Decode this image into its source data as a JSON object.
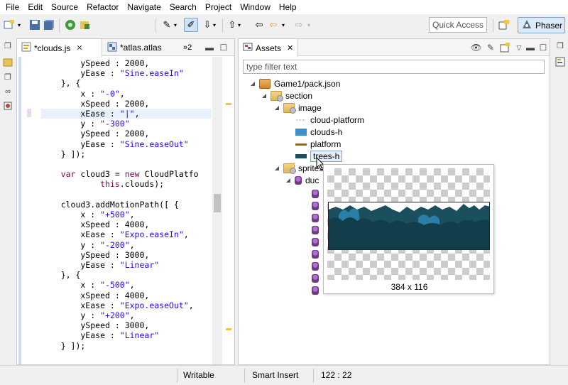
{
  "menu": [
    "File",
    "Edit",
    "Source",
    "Refactor",
    "Navigate",
    "Search",
    "Project",
    "Window",
    "Help"
  ],
  "toolbar": {
    "quick_access_placeholder": "Quick Access",
    "perspective_label": "Phaser"
  },
  "editor": {
    "tabs": [
      {
        "label": "*clouds.js",
        "active": true
      },
      {
        "label": "*atlas.atlas",
        "active": false
      }
    ],
    "overflow_count": "»2",
    "code_lines": [
      [
        {
          "t": "p",
          "v": "        ySpeed : 2000,"
        }
      ],
      [
        {
          "t": "p",
          "v": "        yEase : "
        },
        {
          "t": "s",
          "v": "\"Sine.easeIn\""
        }
      ],
      [
        {
          "t": "p",
          "v": "    }, {"
        }
      ],
      [
        {
          "t": "p",
          "v": "        x : "
        },
        {
          "t": "s",
          "v": "\"-0\""
        },
        {
          "t": "p",
          "v": ","
        }
      ],
      [
        {
          "t": "p",
          "v": "        xSpeed : 2000,"
        }
      ],
      [
        {
          "t": "p",
          "v": "        xEase : "
        },
        {
          "t": "s",
          "v": "\"|\""
        },
        {
          "t": "p",
          "v": ","
        }
      ],
      [
        {
          "t": "p",
          "v": "        y : "
        },
        {
          "t": "s",
          "v": "\"-300\""
        }
      ],
      [
        {
          "t": "p",
          "v": "        ySpeed : 2000,"
        }
      ],
      [
        {
          "t": "p",
          "v": "        yEase : "
        },
        {
          "t": "s",
          "v": "\"Sine.easeOut\""
        }
      ],
      [
        {
          "t": "p",
          "v": "    } ]);"
        }
      ],
      [
        {
          "t": "p",
          "v": ""
        }
      ],
      [
        {
          "t": "p",
          "v": "    "
        },
        {
          "t": "k",
          "v": "var"
        },
        {
          "t": "p",
          "v": " cloud3 = "
        },
        {
          "t": "k",
          "v": "new"
        },
        {
          "t": "p",
          "v": " CloudPlatfo"
        }
      ],
      [
        {
          "t": "p",
          "v": "            "
        },
        {
          "t": "k",
          "v": "this"
        },
        {
          "t": "p",
          "v": ".clouds);"
        }
      ],
      [
        {
          "t": "p",
          "v": ""
        }
      ],
      [
        {
          "t": "p",
          "v": "    cloud3.addMotionPath([ {"
        }
      ],
      [
        {
          "t": "p",
          "v": "        x : "
        },
        {
          "t": "s",
          "v": "\"+500\""
        },
        {
          "t": "p",
          "v": ","
        }
      ],
      [
        {
          "t": "p",
          "v": "        xSpeed : 4000,"
        }
      ],
      [
        {
          "t": "p",
          "v": "        xEase : "
        },
        {
          "t": "s",
          "v": "\"Expo.easeIn\""
        },
        {
          "t": "p",
          "v": ","
        }
      ],
      [
        {
          "t": "p",
          "v": "        y : "
        },
        {
          "t": "s",
          "v": "\"-200\""
        },
        {
          "t": "p",
          "v": ","
        }
      ],
      [
        {
          "t": "p",
          "v": "        ySpeed : 3000,"
        }
      ],
      [
        {
          "t": "p",
          "v": "        yEase : "
        },
        {
          "t": "s",
          "v": "\"Linear\""
        }
      ],
      [
        {
          "t": "p",
          "v": "    }, {"
        }
      ],
      [
        {
          "t": "p",
          "v": "        x : "
        },
        {
          "t": "s",
          "v": "\"-500\""
        },
        {
          "t": "p",
          "v": ","
        }
      ],
      [
        {
          "t": "p",
          "v": "        xSpeed : 4000,"
        }
      ],
      [
        {
          "t": "p",
          "v": "        xEase : "
        },
        {
          "t": "s",
          "v": "\"Expo.easeOut\""
        },
        {
          "t": "p",
          "v": ","
        }
      ],
      [
        {
          "t": "p",
          "v": "        y : "
        },
        {
          "t": "s",
          "v": "\"+200\""
        },
        {
          "t": "p",
          "v": ","
        }
      ],
      [
        {
          "t": "p",
          "v": "        ySpeed : 3000,"
        }
      ],
      [
        {
          "t": "p",
          "v": "        yEase : "
        },
        {
          "t": "s",
          "v": "\"Linear\""
        }
      ],
      [
        {
          "t": "p",
          "v": "    } ]);"
        }
      ]
    ],
    "current_line_index": 5
  },
  "assets": {
    "tab_label": "Assets",
    "filter_placeholder": "type filter text",
    "tree": {
      "pack": "Game1/pack.json",
      "section": "section",
      "image_folder": "image",
      "images": [
        "cloud-platform",
        "clouds-h",
        "platform",
        "trees-h"
      ],
      "sprites_folder": "sprites",
      "sprite_item": "duc"
    },
    "preview": {
      "dimensions": "384 x 116"
    }
  },
  "status": {
    "writable": "Writable",
    "insert_mode": "Smart Insert",
    "position": "122 : 22"
  }
}
